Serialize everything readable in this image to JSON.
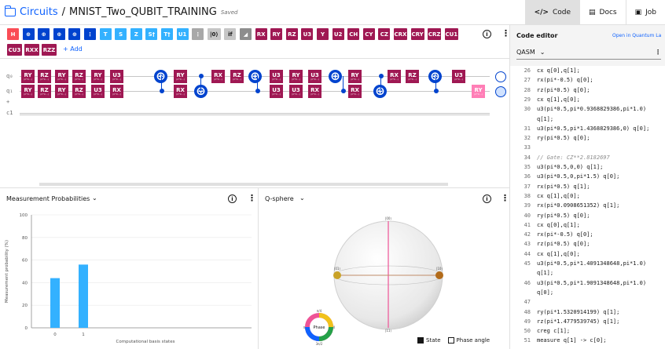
{
  "header": {
    "breadcrumb_root": "Circuits",
    "separator": "/",
    "circuit_name": "MNIST_Two_QUBIT_TRAINING",
    "saved_label": "Saved",
    "tabs": [
      {
        "label": "Code",
        "icon": "code-icon",
        "active": true
      },
      {
        "label": "Docs",
        "icon": "docs-icon"
      },
      {
        "label": "Job",
        "icon": "jobs-icon"
      }
    ]
  },
  "palette": {
    "row1": [
      {
        "label": "H",
        "color": "#fa4d56"
      },
      {
        "label": "⊕",
        "color": "#0043ce"
      },
      {
        "label": "⊕",
        "color": "#0043ce"
      },
      {
        "label": "⊕",
        "color": "#0043ce"
      },
      {
        "label": "⊕",
        "color": "#0043ce"
      },
      {
        "label": "⋮",
        "color": "#0043ce"
      },
      {
        "label": "T",
        "color": "#33b1ff"
      },
      {
        "label": "S",
        "color": "#33b1ff"
      },
      {
        "label": "Z",
        "color": "#33b1ff"
      },
      {
        "label": "S†",
        "color": "#33b1ff"
      },
      {
        "label": "T†",
        "color": "#33b1ff"
      },
      {
        "label": "U1",
        "color": "#33b1ff"
      },
      {
        "label": "⋮",
        "color": "#a8a8a8"
      },
      {
        "label": "|0⟩",
        "color": "#c6c6c6"
      },
      {
        "label": "if",
        "color": "#c6c6c6"
      },
      {
        "label": "◢",
        "color": "#8d8d8d"
      },
      {
        "label": "RX",
        "color": "#9f1853"
      },
      {
        "label": "RY",
        "color": "#9f1853"
      },
      {
        "label": "RZ",
        "color": "#9f1853"
      },
      {
        "label": "U3",
        "color": "#9f1853"
      },
      {
        "label": "Y",
        "color": "#9f1853"
      },
      {
        "label": "U2",
        "color": "#9f1853"
      },
      {
        "label": "CH",
        "color": "#9f1853"
      },
      {
        "label": "CY",
        "color": "#9f1853"
      },
      {
        "label": "CZ",
        "color": "#9f1853"
      },
      {
        "label": "CRX",
        "color": "#9f1853"
      },
      {
        "label": "CRY",
        "color": "#9f1853"
      },
      {
        "label": "CRZ",
        "color": "#9f1853"
      },
      {
        "label": "CU1",
        "color": "#9f1853"
      }
    ],
    "row2": [
      {
        "label": "CU3",
        "color": "#9f1853"
      },
      {
        "label": "RXX",
        "color": "#9f1853"
      },
      {
        "label": "RZZ",
        "color": "#9f1853"
      }
    ],
    "add_label": "+ Add"
  },
  "circuit": {
    "qubits": [
      "q₀",
      "q₁",
      "+",
      "c1"
    ],
    "q0_gates": [
      "RY",
      "RZ",
      "RY",
      "RZ",
      "RY",
      "U3",
      "⊕",
      "RY",
      "RX",
      "RZ",
      "⊕",
      "U3",
      "RY",
      "U3",
      "⊕",
      "RY",
      "RX",
      "RZ",
      "⊕",
      "U3"
    ],
    "q1_gates": [
      "RY",
      "RZ",
      "RY",
      "RZ",
      "U3",
      "RX",
      "RX",
      "⊕",
      "U3",
      "U3",
      "RX",
      "RX",
      "⊕",
      "RY"
    ],
    "param_text": "(π*0…)"
  },
  "prob": {
    "title": "Measurement Probabilities",
    "ylabel": "Measurement probability (%)",
    "xlabel": "Computational basis states",
    "chart_data": {
      "type": "bar",
      "categories": [
        "0",
        "1"
      ],
      "values": [
        44,
        56
      ],
      "ylim": [
        0,
        100
      ],
      "yticks": [
        0,
        20,
        40,
        60,
        80,
        100
      ],
      "ylabel": "Measurement probability (%)",
      "xlabel": "Computational basis states",
      "color": "#33b1ff"
    }
  },
  "qsphere": {
    "title": "Q-sphere",
    "top": "|00⟩",
    "bottom": "|11⟩",
    "left": "|01⟩",
    "right": "|10⟩",
    "phase_label": "Phase",
    "pi2": "π/4",
    "pi": "π",
    "zero": "0",
    "threepi2": "3π/2",
    "state_label": "State",
    "phase_angle_label": "Phase angle"
  },
  "code_editor": {
    "title": "Code editor",
    "open_link": "Open in Quantum La",
    "lang": "QASM",
    "lines": [
      {
        "n": "26",
        "t": "cx q[0],q[1];"
      },
      {
        "n": "27",
        "t": "rx(pi*-0.5) q[0];"
      },
      {
        "n": "28",
        "t": "rz(pi*0.5) q[0];"
      },
      {
        "n": "29",
        "t": "cx q[1],q[0];"
      },
      {
        "n": "30",
        "t": "u3(pi*0.5,pi*0.9368829386,pi*1.0)"
      },
      {
        "n": "",
        "t": "q[1];"
      },
      {
        "n": "31",
        "t": "u3(pi*0.5,pi*1.4368829386,0) q[0];"
      },
      {
        "n": "32",
        "t": "ry(pi*0.5) q[0];"
      },
      {
        "n": "33",
        "t": ""
      },
      {
        "n": "34",
        "t": "// Gate: CZ**2.8182697",
        "c": true
      },
      {
        "n": "35",
        "t": "u3(pi*0.5,0,0) q[1];"
      },
      {
        "n": "36",
        "t": "u3(pi*0.5,0,pi*1.5) q[0];"
      },
      {
        "n": "37",
        "t": "rx(pi*0.5) q[1];"
      },
      {
        "n": "38",
        "t": "cx q[1],q[0];"
      },
      {
        "n": "39",
        "t": "rx(pi*0.0908651352) q[1];"
      },
      {
        "n": "40",
        "t": "ry(pi*0.5) q[0];"
      },
      {
        "n": "41",
        "t": "cx q[0],q[1];"
      },
      {
        "n": "42",
        "t": "rx(pi*-0.5) q[0];"
      },
      {
        "n": "43",
        "t": "rz(pi*0.5) q[0];"
      },
      {
        "n": "44",
        "t": "cx q[1],q[0];"
      },
      {
        "n": "45",
        "t": "u3(pi*0.5,pi*1.4091348648,pi*1.0)"
      },
      {
        "n": "",
        "t": "q[1];"
      },
      {
        "n": "46",
        "t": "u3(pi*0.5,pi*1.9091348648,pi*1.0)"
      },
      {
        "n": "",
        "t": "q[0];"
      },
      {
        "n": "47",
        "t": ""
      },
      {
        "n": "48",
        "t": "ry(pi*1.5320914199) q[1];"
      },
      {
        "n": "49",
        "t": "rz(pi*1.4779539745) q[1];"
      },
      {
        "n": "50",
        "t": "creg c[1];"
      },
      {
        "n": "51",
        "t": "measure q[1] -> c[0];"
      }
    ]
  }
}
